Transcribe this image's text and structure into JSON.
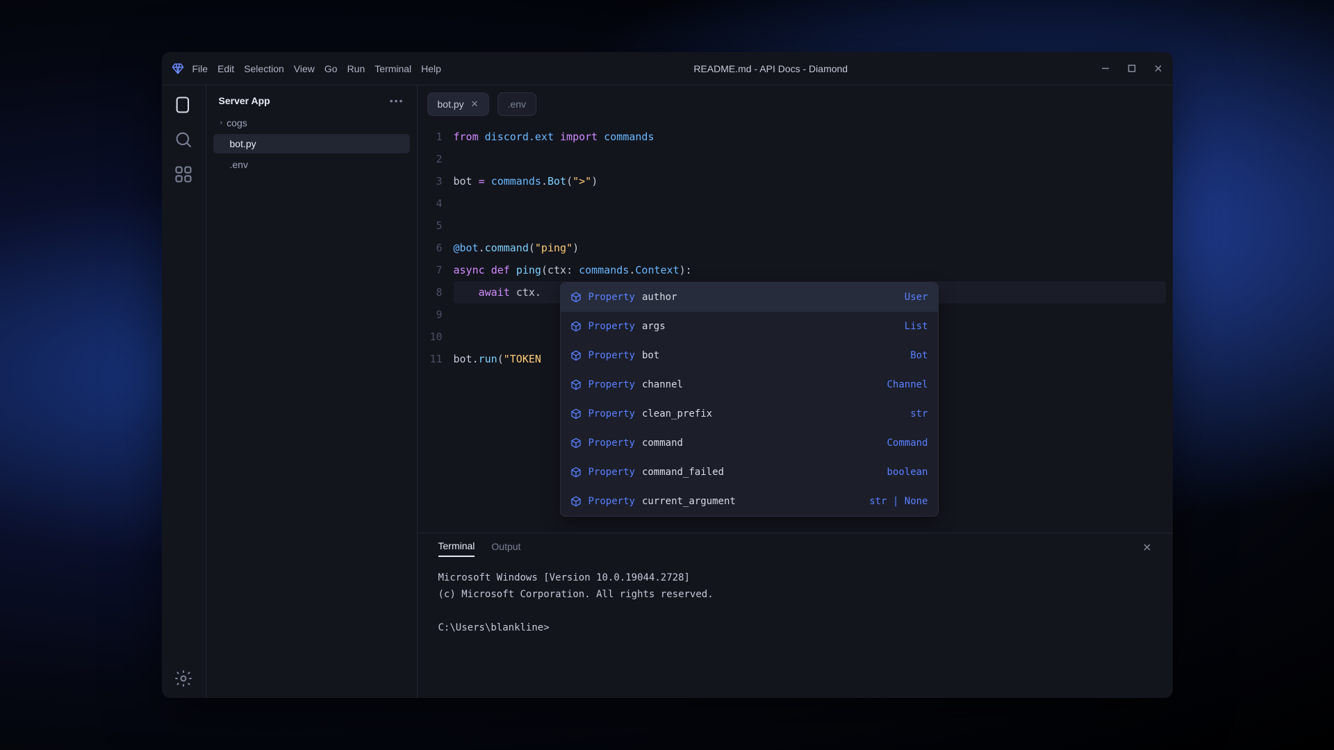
{
  "window_title": "README.md - API Docs - Diamond",
  "menu": [
    "File",
    "Edit",
    "Selection",
    "View",
    "Go",
    "Run",
    "Terminal",
    "Help"
  ],
  "sidebar": {
    "title": "Server App",
    "items": [
      {
        "label": "cogs",
        "kind": "folder"
      },
      {
        "label": "bot.py",
        "kind": "file",
        "active": true
      },
      {
        "label": ".env",
        "kind": "file"
      }
    ]
  },
  "tabs": [
    {
      "label": "bot.py",
      "active": true,
      "closable": true
    },
    {
      "label": ".env",
      "active": false,
      "closable": false
    }
  ],
  "code": {
    "lines": [
      {
        "n": 1,
        "tokens": [
          {
            "t": "from ",
            "c": "kw"
          },
          {
            "t": "discord.ext ",
            "c": "cls"
          },
          {
            "t": "import ",
            "c": "kw"
          },
          {
            "t": "commands",
            "c": "cls"
          }
        ]
      },
      {
        "n": 2,
        "tokens": []
      },
      {
        "n": 3,
        "tokens": [
          {
            "t": "bot ",
            "c": "op"
          },
          {
            "t": "= ",
            "c": "kw"
          },
          {
            "t": "commands",
            "c": "cls"
          },
          {
            "t": ".",
            "c": "op"
          },
          {
            "t": "Bot",
            "c": "fn"
          },
          {
            "t": "(",
            "c": "op"
          },
          {
            "t": "\">\"",
            "c": "str"
          },
          {
            "t": ")",
            "c": "op"
          }
        ]
      },
      {
        "n": 4,
        "tokens": []
      },
      {
        "n": 5,
        "tokens": []
      },
      {
        "n": 6,
        "tokens": [
          {
            "t": "@bot",
            "c": "dec"
          },
          {
            "t": ".",
            "c": "op"
          },
          {
            "t": "command",
            "c": "fn"
          },
          {
            "t": "(",
            "c": "op"
          },
          {
            "t": "\"ping\"",
            "c": "str"
          },
          {
            "t": ")",
            "c": "op"
          }
        ]
      },
      {
        "n": 7,
        "tokens": [
          {
            "t": "async ",
            "c": "kw"
          },
          {
            "t": "def ",
            "c": "kw"
          },
          {
            "t": "ping",
            "c": "fn"
          },
          {
            "t": "(",
            "c": "op"
          },
          {
            "t": "ctx",
            "c": "op"
          },
          {
            "t": ": ",
            "c": "op"
          },
          {
            "t": "commands",
            "c": "cls"
          },
          {
            "t": ".",
            "c": "op"
          },
          {
            "t": "Context",
            "c": "cls"
          },
          {
            "t": "):",
            "c": "op"
          }
        ]
      },
      {
        "n": 8,
        "hl": true,
        "tokens": [
          {
            "t": "    await ",
            "c": "kw"
          },
          {
            "t": "ctx",
            "c": "op"
          },
          {
            "t": ".",
            "c": "op"
          }
        ]
      },
      {
        "n": 9,
        "tokens": []
      },
      {
        "n": 10,
        "tokens": []
      },
      {
        "n": 11,
        "tokens": [
          {
            "t": "bot",
            "c": "op"
          },
          {
            "t": ".",
            "c": "op"
          },
          {
            "t": "run",
            "c": "fn"
          },
          {
            "t": "(",
            "c": "op"
          },
          {
            "t": "\"TOKEN",
            "c": "str"
          }
        ]
      }
    ]
  },
  "popup": [
    {
      "kind": "Property",
      "name": "author",
      "type": "User",
      "selected": true
    },
    {
      "kind": "Property",
      "name": "args",
      "type": "List"
    },
    {
      "kind": "Property",
      "name": "bot",
      "type": "Bot"
    },
    {
      "kind": "Property",
      "name": "channel",
      "type": "Channel"
    },
    {
      "kind": "Property",
      "name": "clean_prefix",
      "type": "str"
    },
    {
      "kind": "Property",
      "name": "command",
      "type": "Command"
    },
    {
      "kind": "Property",
      "name": "command_failed",
      "type": "boolean"
    },
    {
      "kind": "Property",
      "name": "current_argument",
      "type": "str | None"
    }
  ],
  "panel": {
    "tabs": [
      {
        "label": "Terminal",
        "active": true
      },
      {
        "label": "Output",
        "active": false
      }
    ],
    "terminal": "Microsoft Windows [Version 10.0.19044.2728]\n(c) Microsoft Corporation. All rights reserved.\n\nC:\\Users\\blankline>"
  }
}
